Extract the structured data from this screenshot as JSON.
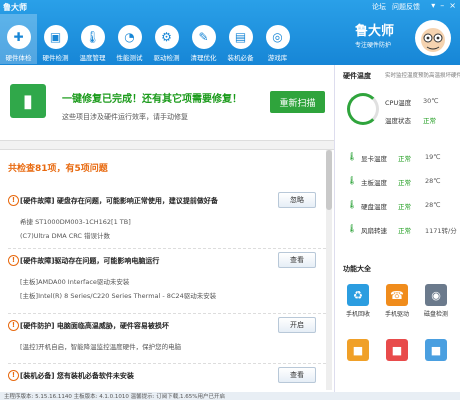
{
  "app": {
    "title": "鲁大师"
  },
  "toplinks": [
    "论坛",
    "问题反馈"
  ],
  "nav": [
    {
      "label": "硬件体检",
      "icon": "health-check-icon",
      "glyph": "✚",
      "active": true
    },
    {
      "label": "硬件检测",
      "icon": "hardware-icon",
      "glyph": "▣"
    },
    {
      "label": "温度管理",
      "icon": "thermometer-icon",
      "glyph": "🌡"
    },
    {
      "label": "性能测试",
      "icon": "performance-icon",
      "glyph": "◔"
    },
    {
      "label": "驱动检测",
      "icon": "driver-icon",
      "glyph": "⚙"
    },
    {
      "label": "清理优化",
      "icon": "broom-icon",
      "glyph": "✎"
    },
    {
      "label": "装机必备",
      "icon": "install-icon",
      "glyph": "▤"
    },
    {
      "label": "游戏库",
      "icon": "gamepad-icon",
      "glyph": "◎"
    }
  ],
  "brand": {
    "name": "鲁大师",
    "slogan": "专注硬件防护"
  },
  "card": {
    "title": "一键修复已完成！还有其它项需要修复！",
    "subtitle": "这些项目涉及硬件运行效率，请手动修复",
    "rescan_label": "重新扫描"
  },
  "summary": "共检查81项，有5项问题",
  "issues": [
    {
      "title": "[硬件故障] 硬盘存在问题，可能影响正常使用，建议提前做好备",
      "lines": [
        "希捷 ST1000DM003-1CH162[1 TB]",
        "(C7)Ultra DMA CRC 错误计数"
      ],
      "button": "忽略"
    },
    {
      "title": "[硬件故障]驱动存在问题，可能影响电脑运行",
      "lines": [
        "[主板]AMDA00 Interface驱动未安装",
        "[主板]Intel(R) 8 Series/C220 Series Thermal - 8C24驱动未安装"
      ],
      "button": "查看"
    },
    {
      "title": "[硬件防护] 电脑面临高温威胁，硬件容易被损坏",
      "lines": [
        "[温控]开机自启，智能降温监控温度硬件，保护您的电脑"
      ],
      "button": "开启"
    },
    {
      "title": "[装机必备] 您有装机必备软件未安装",
      "lines": [],
      "button": "查看"
    }
  ],
  "side": {
    "temp_title": "硬件温度",
    "temp_sub": "实时监控温度预防高温损坏硬件",
    "cpu_label": "CPU温度",
    "cpu_val": "30℃",
    "state_label": "温度状态",
    "state_val": "正常",
    "rows": [
      {
        "name": "显卡温度",
        "status": "正常",
        "value": "19℃",
        "icon": "gpu-temp-icon"
      },
      {
        "name": "主板温度",
        "status": "正常",
        "value": "28℃",
        "icon": "board-temp-icon"
      },
      {
        "name": "硬盘温度",
        "status": "正常",
        "value": "28℃",
        "icon": "disk-temp-icon"
      },
      {
        "name": "风扇转速",
        "status": "正常",
        "value": "1171转/分",
        "icon": "fan-icon"
      }
    ],
    "tools_title": "功能大全",
    "tools": [
      {
        "label": "手机回收",
        "icon": "phone-recycle-icon",
        "color": "#2b9de0",
        "glyph": "♻"
      },
      {
        "label": "手机驱动",
        "icon": "phone-driver-icon",
        "color": "#f08c1c",
        "glyph": "☎"
      },
      {
        "label": "磁盘检测",
        "icon": "disk-check-icon",
        "color": "#6b7a8c",
        "glyph": "◉"
      },
      {
        "label": "",
        "icon": "tool-icon-1",
        "color": "#f0a028",
        "glyph": "■"
      },
      {
        "label": "",
        "icon": "tool-icon-2",
        "color": "#e84b4b",
        "glyph": "■"
      },
      {
        "label": "",
        "icon": "tool-icon-3",
        "color": "#4a9fe0",
        "glyph": "■"
      }
    ]
  },
  "status": {
    "text": "主程序版本: 5.15.16.1140    主板版本: 4.1.0.1010    温馨提示: 订阅下载,1.65%用户已开启"
  }
}
